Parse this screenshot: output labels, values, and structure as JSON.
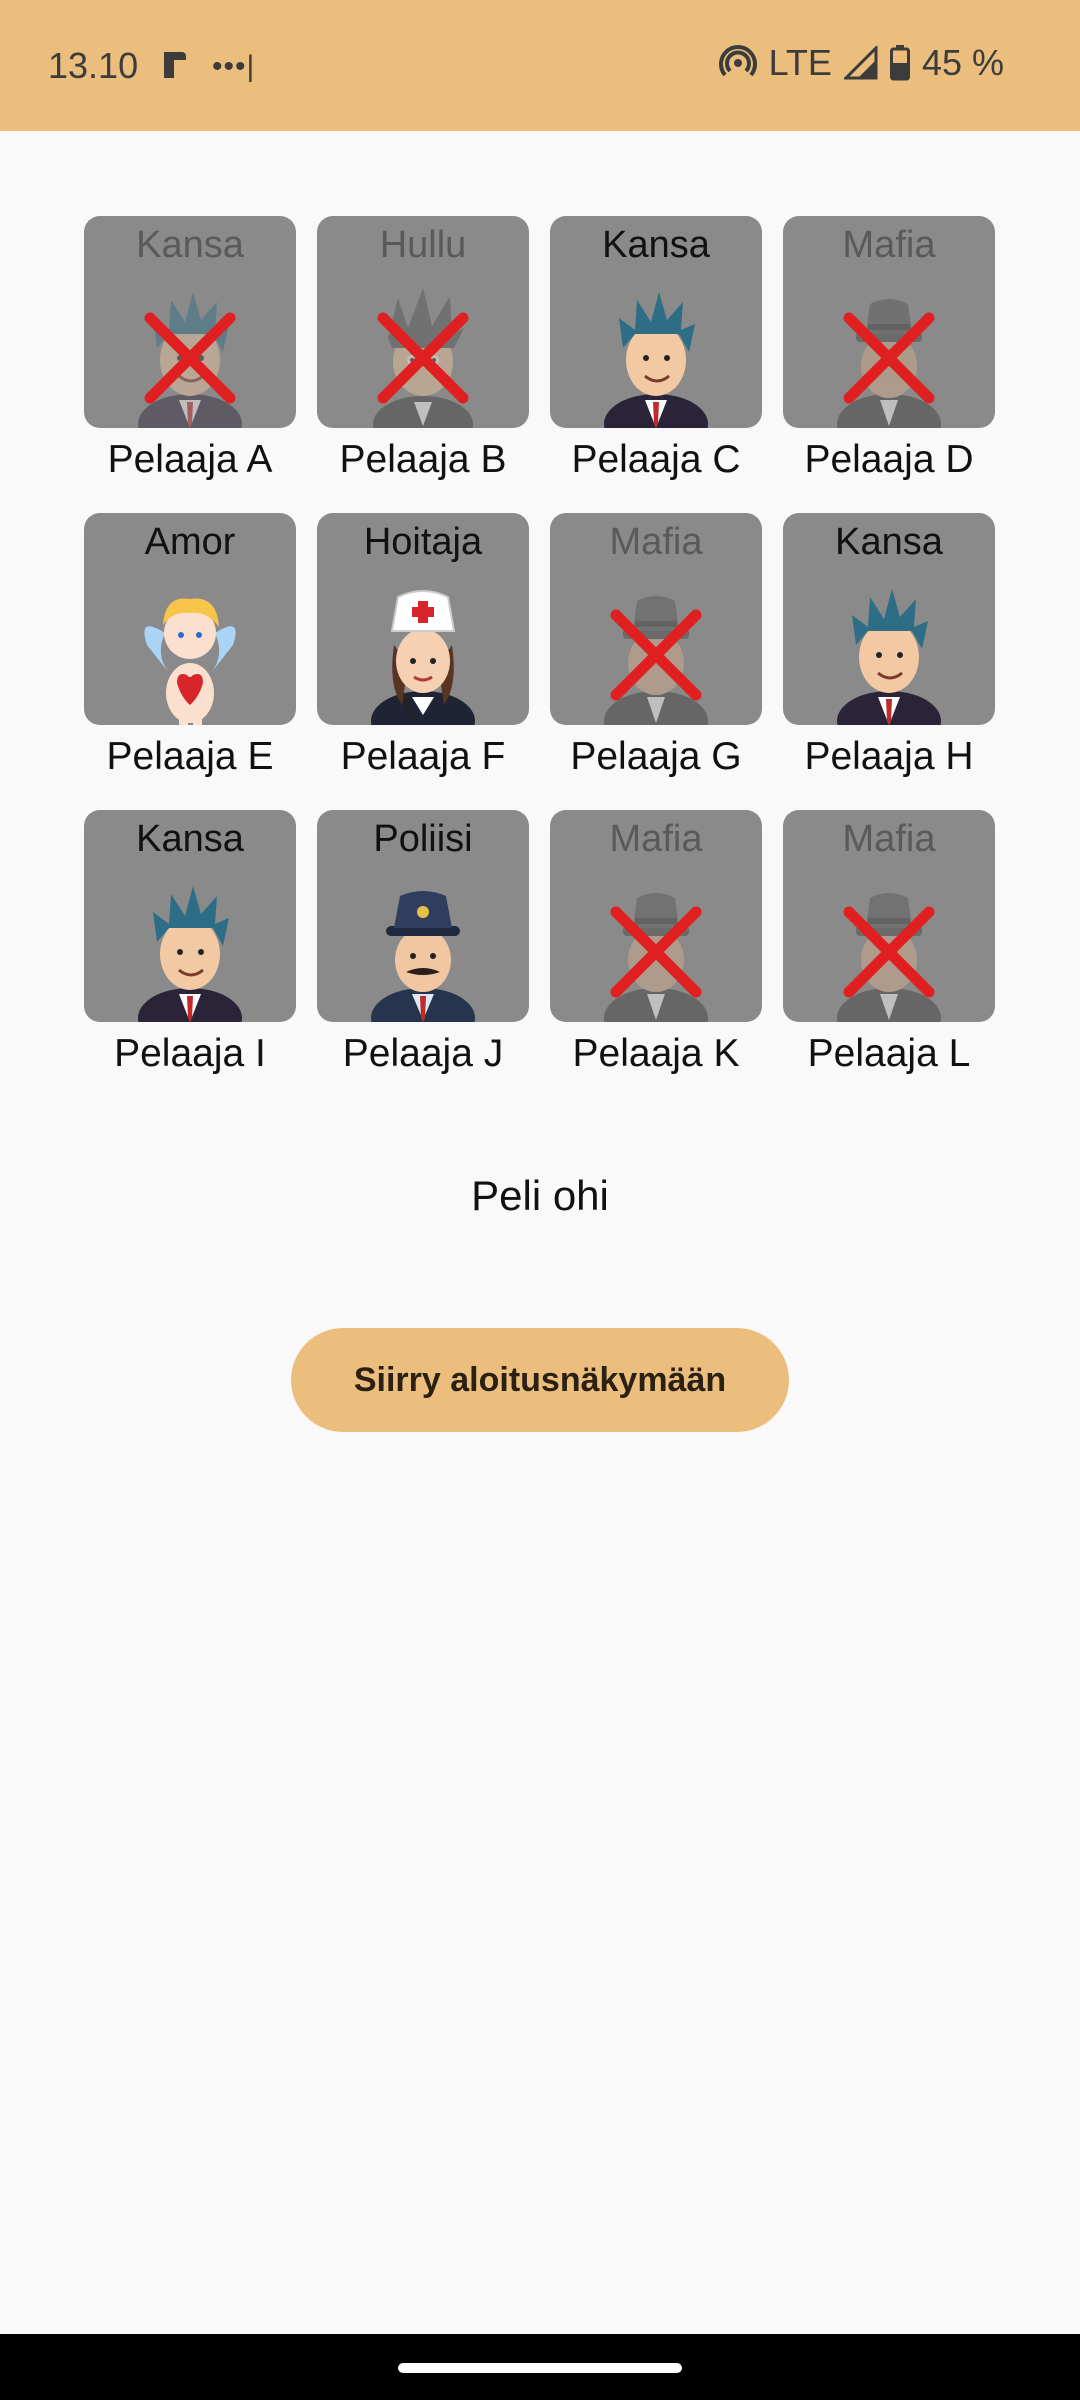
{
  "status_bar": {
    "time": "13.10",
    "app_icon": "app-notification-icon",
    "more_icon": "more-dots-icon",
    "network": "LTE",
    "battery": "45 %"
  },
  "players": [
    {
      "name": "Pelaaja A",
      "role": "Kansa",
      "alive": false,
      "portrait": "citizen"
    },
    {
      "name": "Pelaaja B",
      "role": "Hullu",
      "alive": false,
      "portrait": "crazy"
    },
    {
      "name": "Pelaaja C",
      "role": "Kansa",
      "alive": true,
      "portrait": "citizen"
    },
    {
      "name": "Pelaaja D",
      "role": "Mafia",
      "alive": false,
      "portrait": "mafia"
    },
    {
      "name": "Pelaaja E",
      "role": "Amor",
      "alive": true,
      "portrait": "cupid"
    },
    {
      "name": "Pelaaja F",
      "role": "Hoitaja",
      "alive": true,
      "portrait": "nurse"
    },
    {
      "name": "Pelaaja G",
      "role": "Mafia",
      "alive": false,
      "portrait": "mafia"
    },
    {
      "name": "Pelaaja H",
      "role": "Kansa",
      "alive": true,
      "portrait": "citizen"
    },
    {
      "name": "Pelaaja I",
      "role": "Kansa",
      "alive": true,
      "portrait": "citizen"
    },
    {
      "name": "Pelaaja J",
      "role": "Poliisi",
      "alive": true,
      "portrait": "police"
    },
    {
      "name": "Pelaaja K",
      "role": "Mafia",
      "alive": false,
      "portrait": "mafia"
    },
    {
      "name": "Pelaaja L",
      "role": "Mafia",
      "alive": false,
      "portrait": "mafia"
    }
  ],
  "game_status": "Peli ohi",
  "home_button_label": "Siirry aloitusnäkymään"
}
